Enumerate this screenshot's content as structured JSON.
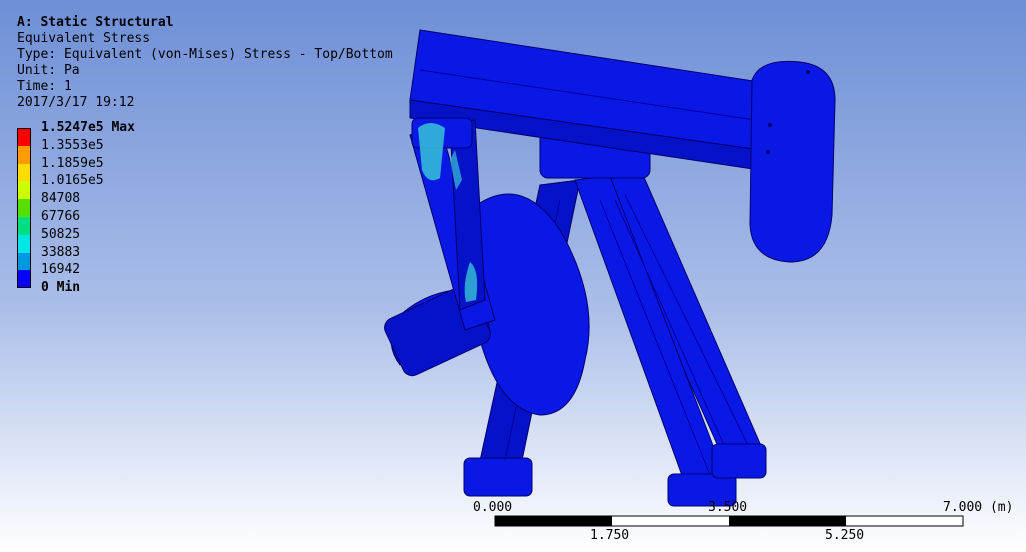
{
  "header": {
    "analysis": "A: Static Structural",
    "result": "Equivalent Stress",
    "type": "Type: Equivalent (von-Mises) Stress - Top/Bottom",
    "unit": "Unit: Pa",
    "time": "Time: 1",
    "date": "2017/3/17 19:12"
  },
  "legend": {
    "entries": [
      {
        "label": "1.5247e5 Max",
        "color": "#ff0000"
      },
      {
        "label": "1.3553e5",
        "color": "#ff9a00"
      },
      {
        "label": "1.1859e5",
        "color": "#ffdd00"
      },
      {
        "label": "1.0165e5",
        "color": "#ccff00"
      },
      {
        "label": "84708",
        "color": "#55e000"
      },
      {
        "label": "67766",
        "color": "#00e080"
      },
      {
        "label": "50825",
        "color": "#00e6e6"
      },
      {
        "label": "33883",
        "color": "#0099e0"
      },
      {
        "label": "16942",
        "color": "#0000ff"
      },
      {
        "label": "0 Min",
        "color": null
      }
    ]
  },
  "scale_bar": {
    "top_labels": [
      "0.000",
      "3.500",
      "7.000 (m)"
    ],
    "bottom_labels": [
      "1.750",
      "5.250"
    ]
  },
  "colors": {
    "model_dark": "#0000a0",
    "model": "#0a18e6",
    "model_light": "#2d3bff",
    "hotspot": "#36c3d6"
  }
}
